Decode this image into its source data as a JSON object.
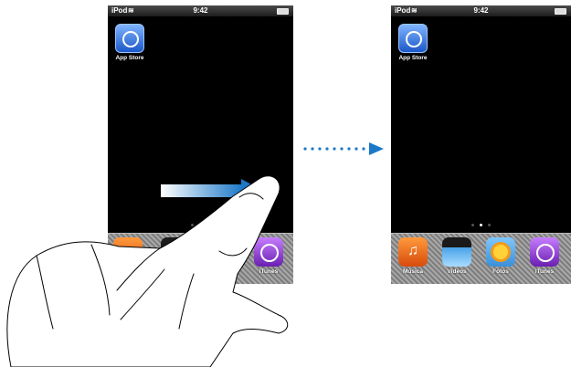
{
  "status_bar": {
    "carrier": "iPod",
    "time": "9:42"
  },
  "home_app": {
    "label": "App Store",
    "icon": "app-store-icon"
  },
  "page_indicator": {
    "count": 3
  },
  "dock": {
    "items": [
      {
        "label": "Música",
        "icon": "music-icon"
      },
      {
        "label": "Vídeos",
        "icon": "videos-icon"
      },
      {
        "label": "Fotos",
        "icon": "photos-icon"
      },
      {
        "label": "iTunes",
        "icon": "itunes-icon"
      }
    ]
  },
  "left_partial_dock_labels": {
    "fotos_fragment": "tos",
    "itunes": "iTunes"
  },
  "colors": {
    "arrow": "#1b78c8",
    "screen": "#000000"
  }
}
